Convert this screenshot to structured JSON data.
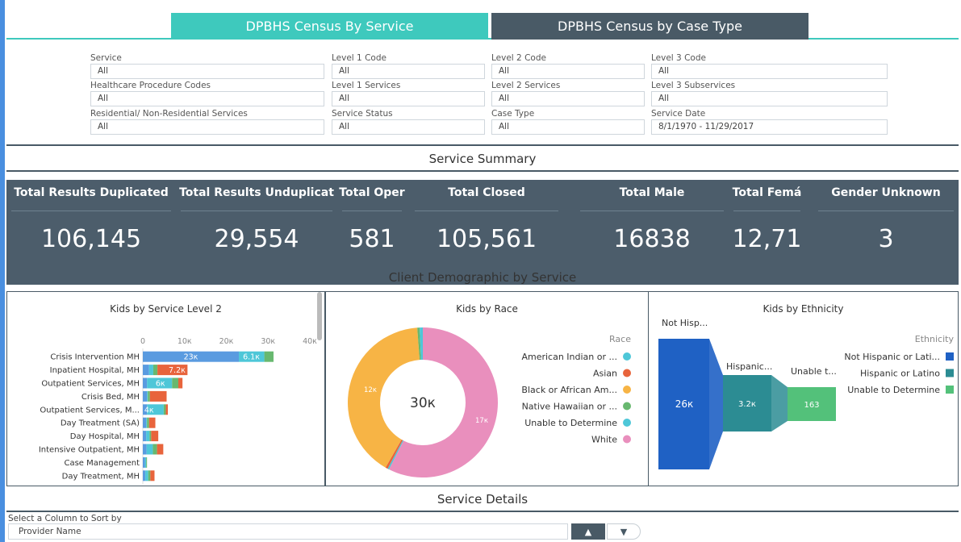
{
  "tabs": [
    {
      "label": "DPBHS Census By Service"
    },
    {
      "label": "DPBHS Census by Case Type"
    }
  ],
  "filters": [
    {
      "label": "Service",
      "value": "All"
    },
    {
      "label": "Level 1 Code",
      "value": "All"
    },
    {
      "label": "Level 2 Code",
      "value": "All"
    },
    {
      "label": "Level 3 Code",
      "value": "All"
    },
    {
      "label": "Healthcare Procedure Codes",
      "value": "All"
    },
    {
      "label": "Level 1 Services",
      "value": "All"
    },
    {
      "label": "Level 2 Services",
      "value": "All"
    },
    {
      "label": "Level 3 Subservices",
      "value": "All"
    },
    {
      "label": "Residential/ Non-Residential Services",
      "value": "All"
    },
    {
      "label": "Service Status",
      "value": "All"
    },
    {
      "label": "Case Type",
      "value": "All"
    },
    {
      "label": "Service Date",
      "value": "8/1/1970 - 11/29/2017"
    }
  ],
  "service_summary": {
    "title": "Service Summary",
    "kpis": [
      {
        "label": "Total Results Duplicated",
        "value": "106,145"
      },
      {
        "label": "Total Results Unduplicat",
        "value": "29,554"
      },
      {
        "label": "Total Oper",
        "value": "581"
      },
      {
        "label": "Total Closed",
        "value": "105,561"
      },
      {
        "label": "Total Male",
        "value": "16838"
      },
      {
        "label": "Total Femá",
        "value": "12,71"
      },
      {
        "label": "Gender Unknown",
        "value": "3"
      }
    ]
  },
  "demographics_title": "Client Demographic by Service",
  "colors": {
    "teal": "#3ec9bd",
    "slate": "#495a66",
    "blue": "#5a9be0",
    "orange": "#e8643c",
    "yellow": "#f7b445",
    "green": "#68b86f",
    "cyan": "#4ec7d8",
    "pink": "#e98fbd",
    "dark_blue": "#1f61c4",
    "mid_teal": "#2c8c93",
    "light_green": "#53c17a"
  },
  "chart_data": [
    {
      "type": "bar",
      "title": "Kids by Service Level 2",
      "xticks": [
        "0",
        "10к",
        "20к",
        "30к",
        "40к"
      ],
      "xlim": [
        0,
        40000
      ],
      "categories": [
        "Crisis Intervention MH",
        "Inpatient Hospital, MH",
        "Outpatient Services, MH",
        "Crisis Bed, MH",
        "Outpatient Services, M...",
        "Day Treatment (SA)",
        "Day Hospital, MH",
        "Intensive Outpatient, MH",
        "Case Management",
        "Day Treatment, MH"
      ],
      "series": [
        {
          "values": [
            23000,
            1500,
            1000,
            1000,
            1000,
            800,
            800,
            900,
            500,
            600
          ]
        },
        {
          "values": [
            6100,
            1000,
            6000,
            200,
            4000,
            200,
            800,
            1500,
            300,
            700
          ]
        },
        {
          "values": [
            2200,
            1000,
            1500,
            500,
            500,
            500,
            400,
            1000,
            200,
            500
          ]
        },
        {
          "values": [
            0,
            7200,
            1000,
            4000,
            500,
            1500,
            1700,
            1500,
            0,
            1000
          ]
        }
      ],
      "data_labels": [
        "23к",
        "6.1к",
        "7.2к",
        "6к",
        "4к"
      ]
    },
    {
      "type": "pie",
      "title": "Kids by Race",
      "legend_title": "Race",
      "center_label": "30к",
      "slices": [
        {
          "label": "American Indian or ...",
          "value": 100,
          "color": "#4ec7d8"
        },
        {
          "label": "Asian",
          "value": 150,
          "color": "#e8643c"
        },
        {
          "label": "Black or African Am...",
          "value": 12000,
          "color": "#f7b445"
        },
        {
          "label": "Native Hawaiian or ...",
          "value": 150,
          "color": "#68b86f"
        },
        {
          "label": "Unable to Determine",
          "value": 200,
          "color": "#4ec7d8"
        },
        {
          "label": "White",
          "value": 17000,
          "color": "#e98fbd"
        }
      ],
      "data_labels": [
        "12к",
        "17к"
      ]
    },
    {
      "type": "funnel",
      "title": "Kids by Ethnicity",
      "legend_title": "Ethnicity",
      "stages": [
        {
          "label": "Not Hisp...",
          "legend": "Not Hispanic or Lati...",
          "value_label": "26к",
          "color": "#1f61c4"
        },
        {
          "label": "Hispanic...",
          "legend": "Hispanic or Latino",
          "value_label": "3.2к",
          "color": "#2c8c93"
        },
        {
          "label": "Unable t...",
          "legend": "Unable to Determine",
          "value_label": "163",
          "color": "#53c17a"
        }
      ]
    }
  ],
  "service_details": {
    "title": "Service Details",
    "sort_label": "Select a Column to Sort by",
    "sort_value": "Provider Name",
    "asc_icon": "▲",
    "desc_icon": "▼"
  }
}
